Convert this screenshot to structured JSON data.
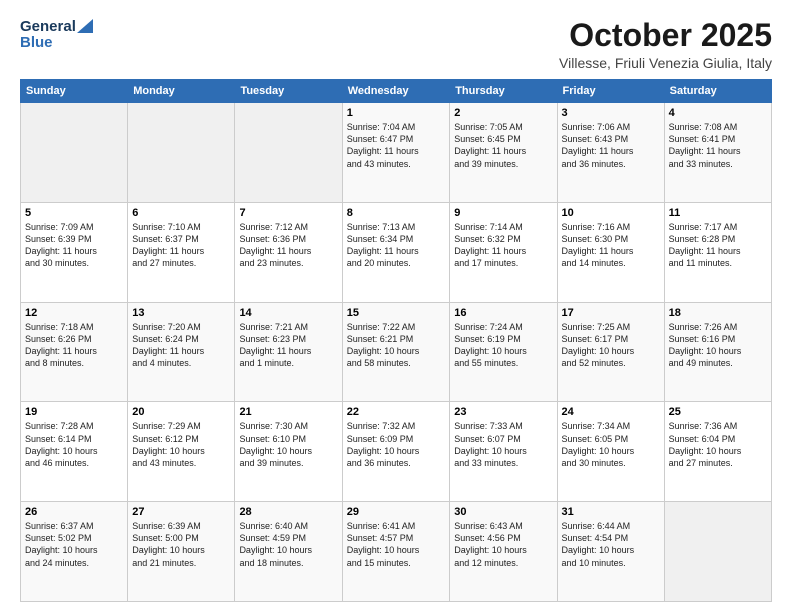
{
  "header": {
    "logo_general": "General",
    "logo_blue": "Blue",
    "month_title": "October 2025",
    "location": "Villesse, Friuli Venezia Giulia, Italy"
  },
  "days_of_week": [
    "Sunday",
    "Monday",
    "Tuesday",
    "Wednesday",
    "Thursday",
    "Friday",
    "Saturday"
  ],
  "weeks": [
    [
      {
        "day": "",
        "info": ""
      },
      {
        "day": "",
        "info": ""
      },
      {
        "day": "",
        "info": ""
      },
      {
        "day": "1",
        "info": "Sunrise: 7:04 AM\nSunset: 6:47 PM\nDaylight: 11 hours\nand 43 minutes."
      },
      {
        "day": "2",
        "info": "Sunrise: 7:05 AM\nSunset: 6:45 PM\nDaylight: 11 hours\nand 39 minutes."
      },
      {
        "day": "3",
        "info": "Sunrise: 7:06 AM\nSunset: 6:43 PM\nDaylight: 11 hours\nand 36 minutes."
      },
      {
        "day": "4",
        "info": "Sunrise: 7:08 AM\nSunset: 6:41 PM\nDaylight: 11 hours\nand 33 minutes."
      }
    ],
    [
      {
        "day": "5",
        "info": "Sunrise: 7:09 AM\nSunset: 6:39 PM\nDaylight: 11 hours\nand 30 minutes."
      },
      {
        "day": "6",
        "info": "Sunrise: 7:10 AM\nSunset: 6:37 PM\nDaylight: 11 hours\nand 27 minutes."
      },
      {
        "day": "7",
        "info": "Sunrise: 7:12 AM\nSunset: 6:36 PM\nDaylight: 11 hours\nand 23 minutes."
      },
      {
        "day": "8",
        "info": "Sunrise: 7:13 AM\nSunset: 6:34 PM\nDaylight: 11 hours\nand 20 minutes."
      },
      {
        "day": "9",
        "info": "Sunrise: 7:14 AM\nSunset: 6:32 PM\nDaylight: 11 hours\nand 17 minutes."
      },
      {
        "day": "10",
        "info": "Sunrise: 7:16 AM\nSunset: 6:30 PM\nDaylight: 11 hours\nand 14 minutes."
      },
      {
        "day": "11",
        "info": "Sunrise: 7:17 AM\nSunset: 6:28 PM\nDaylight: 11 hours\nand 11 minutes."
      }
    ],
    [
      {
        "day": "12",
        "info": "Sunrise: 7:18 AM\nSunset: 6:26 PM\nDaylight: 11 hours\nand 8 minutes."
      },
      {
        "day": "13",
        "info": "Sunrise: 7:20 AM\nSunset: 6:24 PM\nDaylight: 11 hours\nand 4 minutes."
      },
      {
        "day": "14",
        "info": "Sunrise: 7:21 AM\nSunset: 6:23 PM\nDaylight: 11 hours\nand 1 minute."
      },
      {
        "day": "15",
        "info": "Sunrise: 7:22 AM\nSunset: 6:21 PM\nDaylight: 10 hours\nand 58 minutes."
      },
      {
        "day": "16",
        "info": "Sunrise: 7:24 AM\nSunset: 6:19 PM\nDaylight: 10 hours\nand 55 minutes."
      },
      {
        "day": "17",
        "info": "Sunrise: 7:25 AM\nSunset: 6:17 PM\nDaylight: 10 hours\nand 52 minutes."
      },
      {
        "day": "18",
        "info": "Sunrise: 7:26 AM\nSunset: 6:16 PM\nDaylight: 10 hours\nand 49 minutes."
      }
    ],
    [
      {
        "day": "19",
        "info": "Sunrise: 7:28 AM\nSunset: 6:14 PM\nDaylight: 10 hours\nand 46 minutes."
      },
      {
        "day": "20",
        "info": "Sunrise: 7:29 AM\nSunset: 6:12 PM\nDaylight: 10 hours\nand 43 minutes."
      },
      {
        "day": "21",
        "info": "Sunrise: 7:30 AM\nSunset: 6:10 PM\nDaylight: 10 hours\nand 39 minutes."
      },
      {
        "day": "22",
        "info": "Sunrise: 7:32 AM\nSunset: 6:09 PM\nDaylight: 10 hours\nand 36 minutes."
      },
      {
        "day": "23",
        "info": "Sunrise: 7:33 AM\nSunset: 6:07 PM\nDaylight: 10 hours\nand 33 minutes."
      },
      {
        "day": "24",
        "info": "Sunrise: 7:34 AM\nSunset: 6:05 PM\nDaylight: 10 hours\nand 30 minutes."
      },
      {
        "day": "25",
        "info": "Sunrise: 7:36 AM\nSunset: 6:04 PM\nDaylight: 10 hours\nand 27 minutes."
      }
    ],
    [
      {
        "day": "26",
        "info": "Sunrise: 6:37 AM\nSunset: 5:02 PM\nDaylight: 10 hours\nand 24 minutes."
      },
      {
        "day": "27",
        "info": "Sunrise: 6:39 AM\nSunset: 5:00 PM\nDaylight: 10 hours\nand 21 minutes."
      },
      {
        "day": "28",
        "info": "Sunrise: 6:40 AM\nSunset: 4:59 PM\nDaylight: 10 hours\nand 18 minutes."
      },
      {
        "day": "29",
        "info": "Sunrise: 6:41 AM\nSunset: 4:57 PM\nDaylight: 10 hours\nand 15 minutes."
      },
      {
        "day": "30",
        "info": "Sunrise: 6:43 AM\nSunset: 4:56 PM\nDaylight: 10 hours\nand 12 minutes."
      },
      {
        "day": "31",
        "info": "Sunrise: 6:44 AM\nSunset: 4:54 PM\nDaylight: 10 hours\nand 10 minutes."
      },
      {
        "day": "",
        "info": ""
      }
    ]
  ]
}
